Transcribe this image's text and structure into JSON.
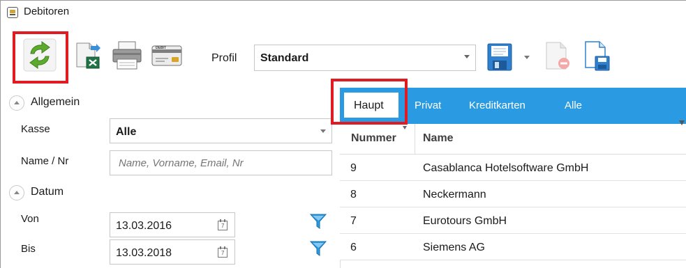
{
  "window": {
    "title": "Debitoren"
  },
  "toolbar": {
    "profil_label": "Profil",
    "profil_value": "Standard",
    "debit_card_text": "DEBIT"
  },
  "left_panel": {
    "section_allgemein": "Allgemein",
    "kasse_label": "Kasse",
    "kasse_value": "Alle",
    "name_label": "Name / Nr",
    "name_placeholder": "Name, Vorname, Email, Nr",
    "section_datum": "Datum",
    "von_label": "Von",
    "von_value": "13.03.2016",
    "bis_label": "Bis",
    "bis_value": "13.03.2018",
    "calendar_day": "7"
  },
  "grid": {
    "tabs": [
      {
        "label": "Haupt"
      },
      {
        "label": "Privat"
      },
      {
        "label": "Kreditkarten"
      },
      {
        "label": "Alle"
      }
    ],
    "columns": [
      "Nummer",
      "Name"
    ],
    "rows": [
      {
        "nummer": "9",
        "name": "Casablanca Hotelsoftware GmbH"
      },
      {
        "nummer": "8",
        "name": "Neckermann"
      },
      {
        "nummer": "7",
        "name": "Eurotours GmbH"
      },
      {
        "nummer": "6",
        "name": "Siemens AG"
      }
    ]
  },
  "colors": {
    "accent": "#2a9be2",
    "highlight": "#e11b22",
    "refresh_green": "#5dab2c"
  },
  "icons": [
    "app-icon",
    "refresh-icon",
    "excel-export-icon",
    "printer-icon",
    "debit-card-icon",
    "chevron-down-icon",
    "save-icon",
    "delete-document-icon",
    "save-as-icon",
    "chevron-up-icon",
    "calendar-icon",
    "filter-icon"
  ]
}
